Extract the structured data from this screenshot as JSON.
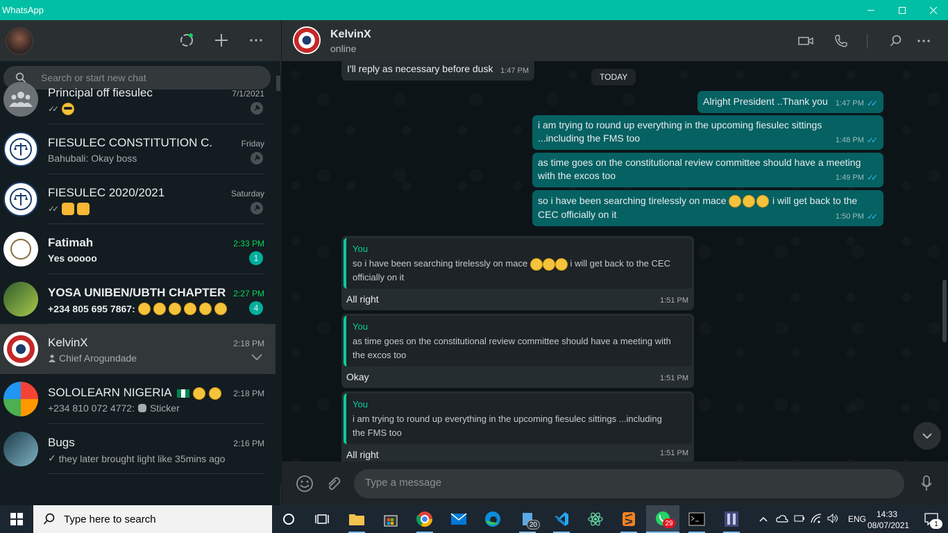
{
  "window": {
    "title": "WhatsApp"
  },
  "search": {
    "placeholder": "Search or start new chat"
  },
  "colors": {
    "accent": "#00bfa5",
    "unread": "#06d755",
    "outgoing": "#056162",
    "incoming": "#262d31"
  },
  "chats": [
    {
      "name": "Principal off fiesulec",
      "time": "7/1/2021",
      "preview": "",
      "pinned": true
    },
    {
      "name": "FIESULEC CONSTITUTION C.",
      "time": "Friday",
      "preview": "Bahubali: Okay boss",
      "pinned": true
    },
    {
      "name": "FIESULEC 2020/2021",
      "time": "Saturday",
      "preview": "",
      "pinned": true
    },
    {
      "name": "Fatimah",
      "time": "2:33 PM",
      "preview": "Yes ooooo",
      "unread": "1"
    },
    {
      "name": "YOSA UNIBEN/UBTH CHAPTER",
      "time": "2:27 PM",
      "preview": "+234 805 695 7867: ",
      "unread": "4"
    },
    {
      "name": "KelvinX",
      "time": "2:18 PM",
      "preview": "Chief Arogundade"
    },
    {
      "name": "SOLOLEARN NIGERIA",
      "time": "2:18 PM",
      "preview": "+234 810 072 4772: ",
      "preview_extra": "Sticker"
    },
    {
      "name": "Bugs",
      "time": "2:16 PM",
      "preview": "they later brought light like 35mins ago"
    }
  ],
  "chat_header": {
    "name": "KelvinX",
    "status": "online"
  },
  "messages": {
    "first_in": {
      "text": "I'll reply as necessary before dusk",
      "time": "1:47 PM"
    },
    "date_separator": "TODAY",
    "out": [
      {
        "text": "Alright President ..Thank you",
        "time": "1:47 PM"
      },
      {
        "line1": "i am trying to round up everything in the upcoming fiesulec sittings",
        "line2": "...including the FMS too",
        "time": "1:48 PM"
      },
      {
        "line1": "as time goes on the constitutional review committee should have a meeting",
        "line2": "with the excos too",
        "time": "1:49 PM"
      },
      {
        "line1a": "so i have been searching tirelessly on mace",
        "line1b": "i will get back to the",
        "line2": "CEC officially on it",
        "time": "1:50 PM"
      }
    ],
    "replies": [
      {
        "who": "You",
        "q1a": "so i have been searching tirelessly on mace",
        "q1b": "i will get back to the CEC",
        "q2": "officially on it",
        "text": "All right",
        "time": "1:51 PM"
      },
      {
        "who": "You",
        "q1": "as time goes on the constitutional review committee should have a meeting with",
        "q2": "the excos too",
        "text": "Okay",
        "time": "1:51 PM"
      },
      {
        "who": "You",
        "q1": "i am trying to round up everything in the upcoming fiesulec sittings ...including",
        "q2": "the FMS too",
        "text": "All right",
        "time": "1:51 PM"
      }
    ]
  },
  "compose": {
    "placeholder": "Type a message"
  },
  "taskbar": {
    "search_label": "Type here to search",
    "file_badge": "20",
    "whatsapp_badge": "29",
    "lang": "ENG",
    "time": "14:33",
    "date": "08/07/2021",
    "notif_count": "1"
  }
}
